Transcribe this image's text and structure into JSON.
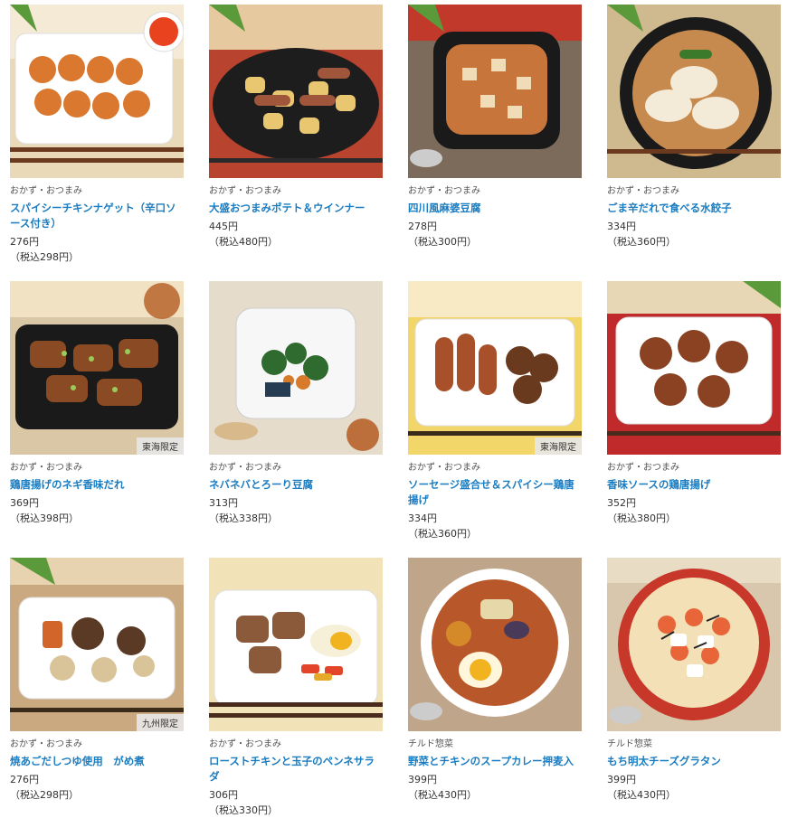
{
  "products": [
    {
      "category": "おかず・おつまみ",
      "name": "スパイシーチキンナゲット（辛口ソース付き）",
      "price": "276円",
      "tax_price": "（税込298円）",
      "region": "",
      "image": "nuggets"
    },
    {
      "category": "おかず・おつまみ",
      "name": "大盛おつまみポテト＆ウインナー",
      "price": "445円",
      "tax_price": "（税込480円）",
      "region": "",
      "image": "potato-sausage"
    },
    {
      "category": "おかず・おつまみ",
      "name": "四川風麻婆豆腐",
      "price": "278円",
      "tax_price": "（税込300円）",
      "region": "",
      "image": "mapo-tofu"
    },
    {
      "category": "おかず・おつまみ",
      "name": "ごま辛だれで食べる水餃子",
      "price": "334円",
      "tax_price": "（税込360円）",
      "region": "",
      "image": "dumplings"
    },
    {
      "category": "おかず・おつまみ",
      "name": "鶏唐揚げのネギ香味だれ",
      "price": "369円",
      "tax_price": "（税込398円）",
      "region": "東海限定",
      "image": "karaage-negi"
    },
    {
      "category": "おかず・おつまみ",
      "name": "ネバネバとろーり豆腐",
      "price": "313円",
      "tax_price": "（税込338円）",
      "region": "",
      "image": "neba-tofu"
    },
    {
      "category": "おかず・おつまみ",
      "name": "ソーセージ盛合せ＆スパイシー鶏唐揚げ",
      "price": "334円",
      "tax_price": "（税込360円）",
      "region": "東海限定",
      "image": "sausage-karaage"
    },
    {
      "category": "おかず・おつまみ",
      "name": "香味ソースの鶏唐揚げ",
      "price": "352円",
      "tax_price": "（税込380円）",
      "region": "",
      "image": "karaage-sauce"
    },
    {
      "category": "おかず・おつまみ",
      "name": "焼あごだしつゆ使用　がめ煮",
      "price": "276円",
      "tax_price": "（税込298円）",
      "region": "九州限定",
      "image": "game-ni"
    },
    {
      "category": "おかず・おつまみ",
      "name": "ローストチキンと玉子のペンネサラダ",
      "price": "306円",
      "tax_price": "（税込330円）",
      "region": "",
      "image": "penne-salad"
    },
    {
      "category": "チルド惣菜",
      "name": "野菜とチキンのスープカレー押麦入",
      "price": "399円",
      "tax_price": "（税込430円）",
      "region": "",
      "image": "soup-curry"
    },
    {
      "category": "チルド惣菜",
      "name": "もち明太チーズグラタン",
      "price": "399円",
      "tax_price": "（税込430円）",
      "region": "",
      "image": "mentai-gratin"
    }
  ]
}
